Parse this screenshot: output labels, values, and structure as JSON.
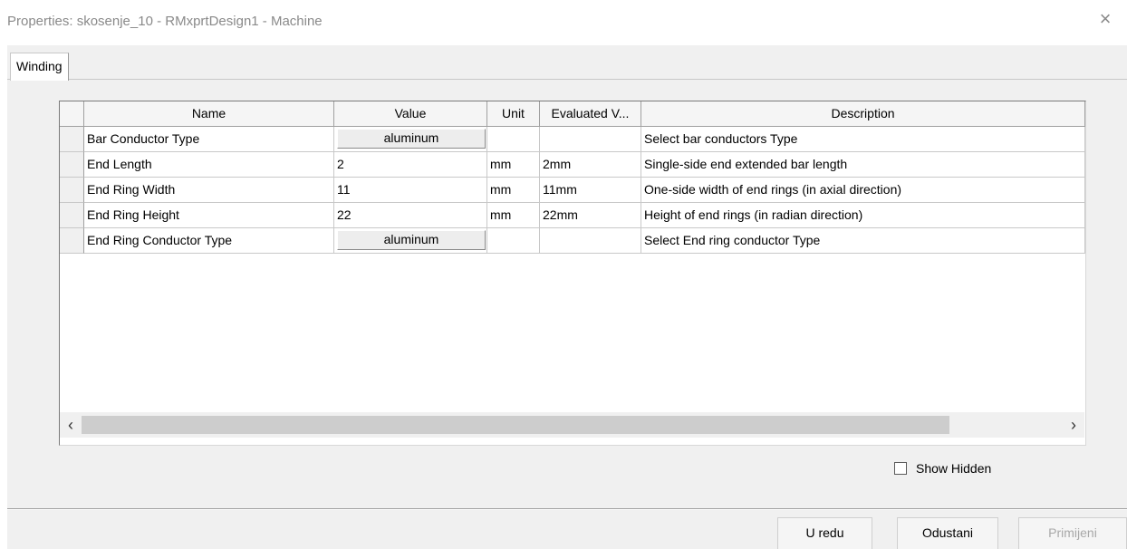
{
  "window": {
    "title": "Properties: skosenje_10 - RMxprtDesign1 - Machine",
    "close_icon": "×"
  },
  "tabs": [
    {
      "label": "Winding"
    }
  ],
  "table": {
    "columns": [
      "Name",
      "Value",
      "Unit",
      "Evaluated V...",
      "Description"
    ],
    "rows": [
      {
        "name": "Bar Conductor Type",
        "value": "aluminum",
        "value_is_button": true,
        "unit": "",
        "evaluated": "",
        "description": "Select bar conductors Type"
      },
      {
        "name": "End Length",
        "value": "2",
        "value_is_button": false,
        "unit": "mm",
        "evaluated": "2mm",
        "description": "Single-side end extended bar length"
      },
      {
        "name": "End Ring Width",
        "value": "11",
        "value_is_button": false,
        "unit": "mm",
        "evaluated": "11mm",
        "description": "One-side width of end rings (in axial direction)"
      },
      {
        "name": "End Ring Height",
        "value": "22",
        "value_is_button": false,
        "unit": "mm",
        "evaluated": "22mm",
        "description": "Height of  end rings (in radian direction)"
      },
      {
        "name": "End Ring Conductor Type",
        "value": "aluminum",
        "value_is_button": true,
        "unit": "",
        "evaluated": "",
        "description": "Select End ring conductor Type"
      }
    ]
  },
  "scrollbar": {
    "left_icon": "‹",
    "right_icon": "›"
  },
  "show_hidden": {
    "label": "Show Hidden",
    "checked": false
  },
  "buttons": {
    "ok": "U redu",
    "cancel": "Odustani",
    "apply": "Primijeni"
  }
}
